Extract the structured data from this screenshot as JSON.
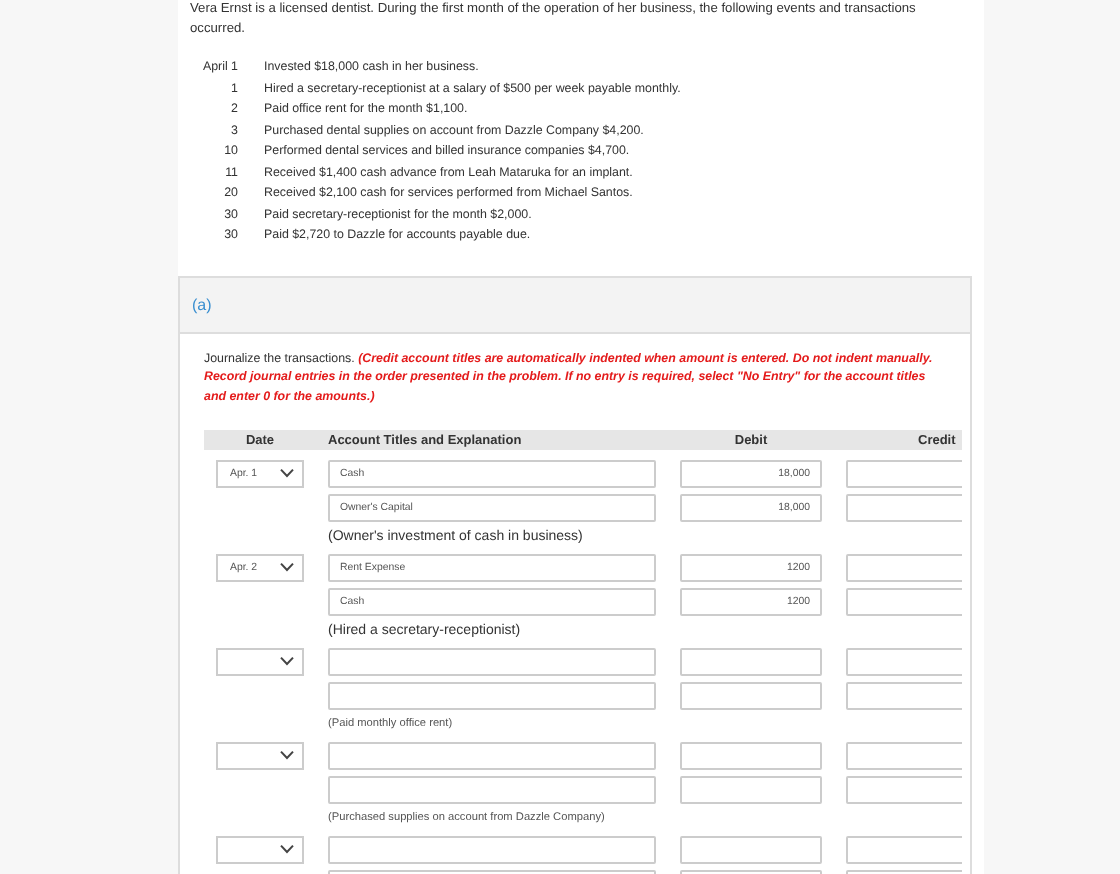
{
  "intro": "Vera Ernst is a licensed dentist. During the first month of the operation of her business, the following events and transactions occurred.",
  "transactions": [
    {
      "date": "April 1",
      "text": "Invested $18,000 cash in her business."
    },
    {
      "date": "1",
      "text": "Hired a secretary-receptionist at a salary of $500 per week payable monthly."
    },
    {
      "date": "2",
      "text": "Paid office rent for the month $1,100."
    },
    {
      "date": "3",
      "text": "Purchased dental supplies on account from Dazzle Company $4,200."
    },
    {
      "date": "10",
      "text": "Performed dental services and billed insurance companies $4,700."
    },
    {
      "date": "11",
      "text": "Received $1,400 cash advance from Leah Mataruka for an implant."
    },
    {
      "date": "20",
      "text": "Received $2,100 cash for services performed from Michael Santos."
    },
    {
      "date": "30",
      "text": "Paid secretary-receptionist for the month $2,000."
    },
    {
      "date": "30",
      "text": "Paid $2,720 to Dazzle for accounts payable due."
    }
  ],
  "part": {
    "label": "(a)",
    "instructions": {
      "text": "Journalize the transactions.",
      "note": "(Credit account titles are automatically indented when amount is entered. Do not indent manually. Record journal entries in the order presented in the problem. If no entry is required, select \"No Entry\" for the account titles and enter 0 for the amounts.)"
    },
    "columns": [
      "Date",
      "Account Titles and Explanation",
      "Debit",
      "Credit"
    ],
    "entries": [
      {
        "date": "Apr. 1",
        "lines": [
          {
            "account": "Cash",
            "debit": "18,000"
          },
          {
            "account": "Owner's Capital",
            "debit": "18,000"
          }
        ],
        "explanation": "(Owner's investment of cash in business)"
      },
      {
        "date": "Apr. 2",
        "lines": [
          {
            "account": "Rent Expense",
            "debit": "1200"
          },
          {
            "account": "Cash",
            "debit": "1200"
          }
        ],
        "explanation": "(Hired a secretary-receptionist)"
      },
      {
        "lines": [
          {
            "kind": "blank"
          },
          {
            "kind": "blank"
          }
        ],
        "explanation": "(Paid monthly office rent)"
      },
      {
        "lines": [
          {
            "kind": "blank"
          },
          {
            "kind": "blank"
          }
        ],
        "explanation": "(Purchased supplies on account from Dazzle Company)"
      },
      {
        "lines": [
          {
            "kind": "blank"
          },
          {
            "kind": "blank"
          }
        ]
      }
    ]
  }
}
